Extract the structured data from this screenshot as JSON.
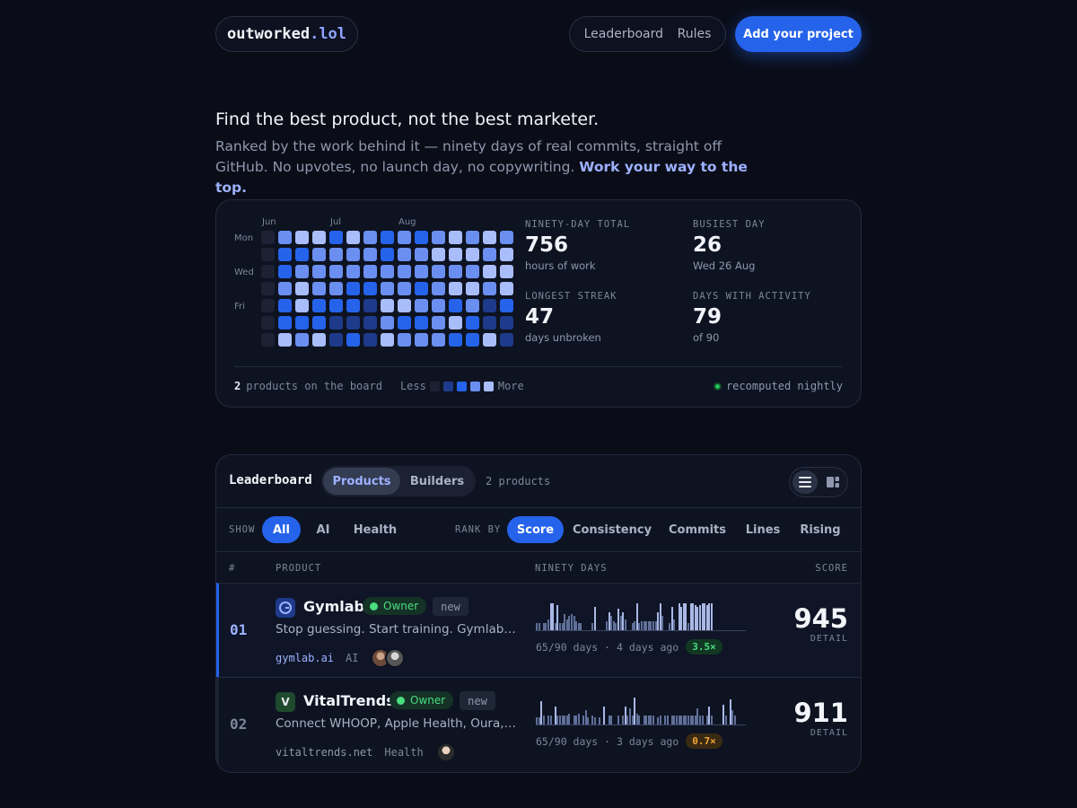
{
  "header": {
    "logo_main": "outworked",
    "logo_accent": ".lol",
    "nav": [
      "Leaderboard",
      "Rules"
    ],
    "cta_label": "Add your project"
  },
  "hero": {
    "title": "Find the best product, not the best marketer.",
    "subtitle": "Ranked by the work behind it — ninety days of real commits, straight off GitHub. No upvotes, no launch day, no copywriting.",
    "accent": "Work your way to the top."
  },
  "heatmap": {
    "months": [
      "Jun",
      "Jul",
      "Aug"
    ],
    "days": [
      "Mon",
      "Wed",
      "Fri"
    ],
    "levels_by_column": [
      [
        0,
        0,
        0,
        0,
        0,
        0,
        0
      ],
      [
        3,
        2,
        2,
        3,
        2,
        2,
        4
      ],
      [
        4,
        2,
        3,
        4,
        4,
        2,
        3
      ],
      [
        4,
        3,
        3,
        3,
        2,
        2,
        4
      ],
      [
        2,
        3,
        3,
        3,
        2,
        1,
        1
      ],
      [
        4,
        3,
        3,
        2,
        2,
        1,
        2
      ],
      [
        3,
        3,
        3,
        2,
        1,
        1,
        1
      ],
      [
        2,
        2,
        3,
        3,
        4,
        3,
        4
      ],
      [
        3,
        3,
        3,
        3,
        4,
        2,
        3
      ],
      [
        2,
        3,
        3,
        2,
        3,
        2,
        3
      ],
      [
        3,
        4,
        3,
        3,
        3,
        3,
        3
      ],
      [
        4,
        4,
        3,
        4,
        2,
        4,
        2
      ],
      [
        3,
        4,
        3,
        4,
        3,
        2,
        2
      ],
      [
        4,
        3,
        4,
        3,
        1,
        1,
        4
      ],
      [
        3,
        4,
        4,
        4,
        2,
        1,
        1
      ]
    ],
    "colors": [
      "#1c2233",
      "#1e3a8a",
      "#2563eb",
      "#6b8ff0",
      "#a9bdfb"
    ]
  },
  "stats": [
    {
      "label": "NINETY-DAY TOTAL",
      "value": "756",
      "sub": "hours of work"
    },
    {
      "label": "BUSIEST DAY",
      "value": "26",
      "sub": "Wed 26 Aug"
    },
    {
      "label": "LONGEST STREAK",
      "value": "47",
      "sub": "days unbroken"
    },
    {
      "label": "DAYS WITH ACTIVITY",
      "value": "79",
      "sub": "of 90"
    }
  ],
  "card_footer": {
    "count": "2",
    "count_label": "products on the board",
    "less": "Less",
    "more": "More",
    "status": "recomputed nightly"
  },
  "board": {
    "title": "Leaderboard",
    "tabs": [
      "Products",
      "Builders"
    ],
    "count": "2 products",
    "show_label": "SHOW",
    "show_filters": [
      "All",
      "AI",
      "Health"
    ],
    "rank_label": "RANK BY",
    "rank_filters": [
      "Score",
      "Consistency",
      "Commits",
      "Lines",
      "Rising"
    ],
    "columns": [
      "#",
      "PRODUCT",
      "NINETY DAYS",
      "SCORE"
    ]
  },
  "rows": [
    {
      "rank": "01",
      "icon": "G",
      "name": "Gymlab",
      "owner": "Owner",
      "tag": "new",
      "desc": "Stop guessing. Start training. Gymlab is a…",
      "url": "gymlab.ai",
      "category": "AI",
      "meta": "65/90 days · 4 days ago",
      "multiplier": "3.5×",
      "score": "945",
      "detail": "DETAIL",
      "spark": [
        8,
        8,
        0,
        8,
        8,
        12,
        30,
        30,
        8,
        28,
        8,
        8,
        18,
        12,
        16,
        18,
        16,
        10,
        8,
        8,
        0,
        0,
        0,
        0,
        8,
        26,
        0,
        0,
        0,
        0,
        10,
        20,
        16,
        10,
        8,
        24,
        16,
        20,
        12,
        0,
        0,
        8,
        10,
        30,
        8,
        10,
        10,
        10,
        10,
        10,
        10,
        10,
        20,
        30,
        16,
        0,
        0,
        8,
        26,
        12,
        0,
        30,
        26,
        30,
        30,
        8,
        30,
        30,
        28,
        26,
        28,
        30,
        30,
        28,
        30,
        30,
        0,
        0,
        0,
        0,
        0,
        0,
        0,
        0,
        0,
        0,
        0,
        0,
        0,
        0
      ]
    },
    {
      "rank": "02",
      "icon": "V",
      "name": "VitalTrends",
      "owner": "Owner",
      "tag": "new",
      "desc": "Connect WHOOP, Apple Health, Oura, Wit…",
      "url": "vitaltrends.net",
      "category": "Health",
      "meta": "65/90 days · 3 days ago",
      "multiplier": "0.7×",
      "score": "911",
      "detail": "DETAIL",
      "spark": [
        8,
        8,
        26,
        10,
        0,
        10,
        10,
        0,
        20,
        10,
        10,
        10,
        10,
        10,
        12,
        0,
        10,
        10,
        12,
        0,
        10,
        16,
        8,
        0,
        10,
        8,
        0,
        8,
        0,
        20,
        0,
        10,
        10,
        0,
        0,
        10,
        0,
        10,
        20,
        10,
        18,
        10,
        30,
        12,
        10,
        0,
        10,
        10,
        10,
        10,
        10,
        0,
        8,
        10,
        0,
        10,
        10,
        0,
        10,
        10,
        10,
        10,
        10,
        10,
        10,
        10,
        10,
        10,
        10,
        18,
        10,
        10,
        0,
        10,
        20,
        10,
        0,
        0,
        0,
        0,
        22,
        10,
        0,
        28,
        16,
        10,
        0,
        0,
        0,
        0
      ]
    }
  ]
}
